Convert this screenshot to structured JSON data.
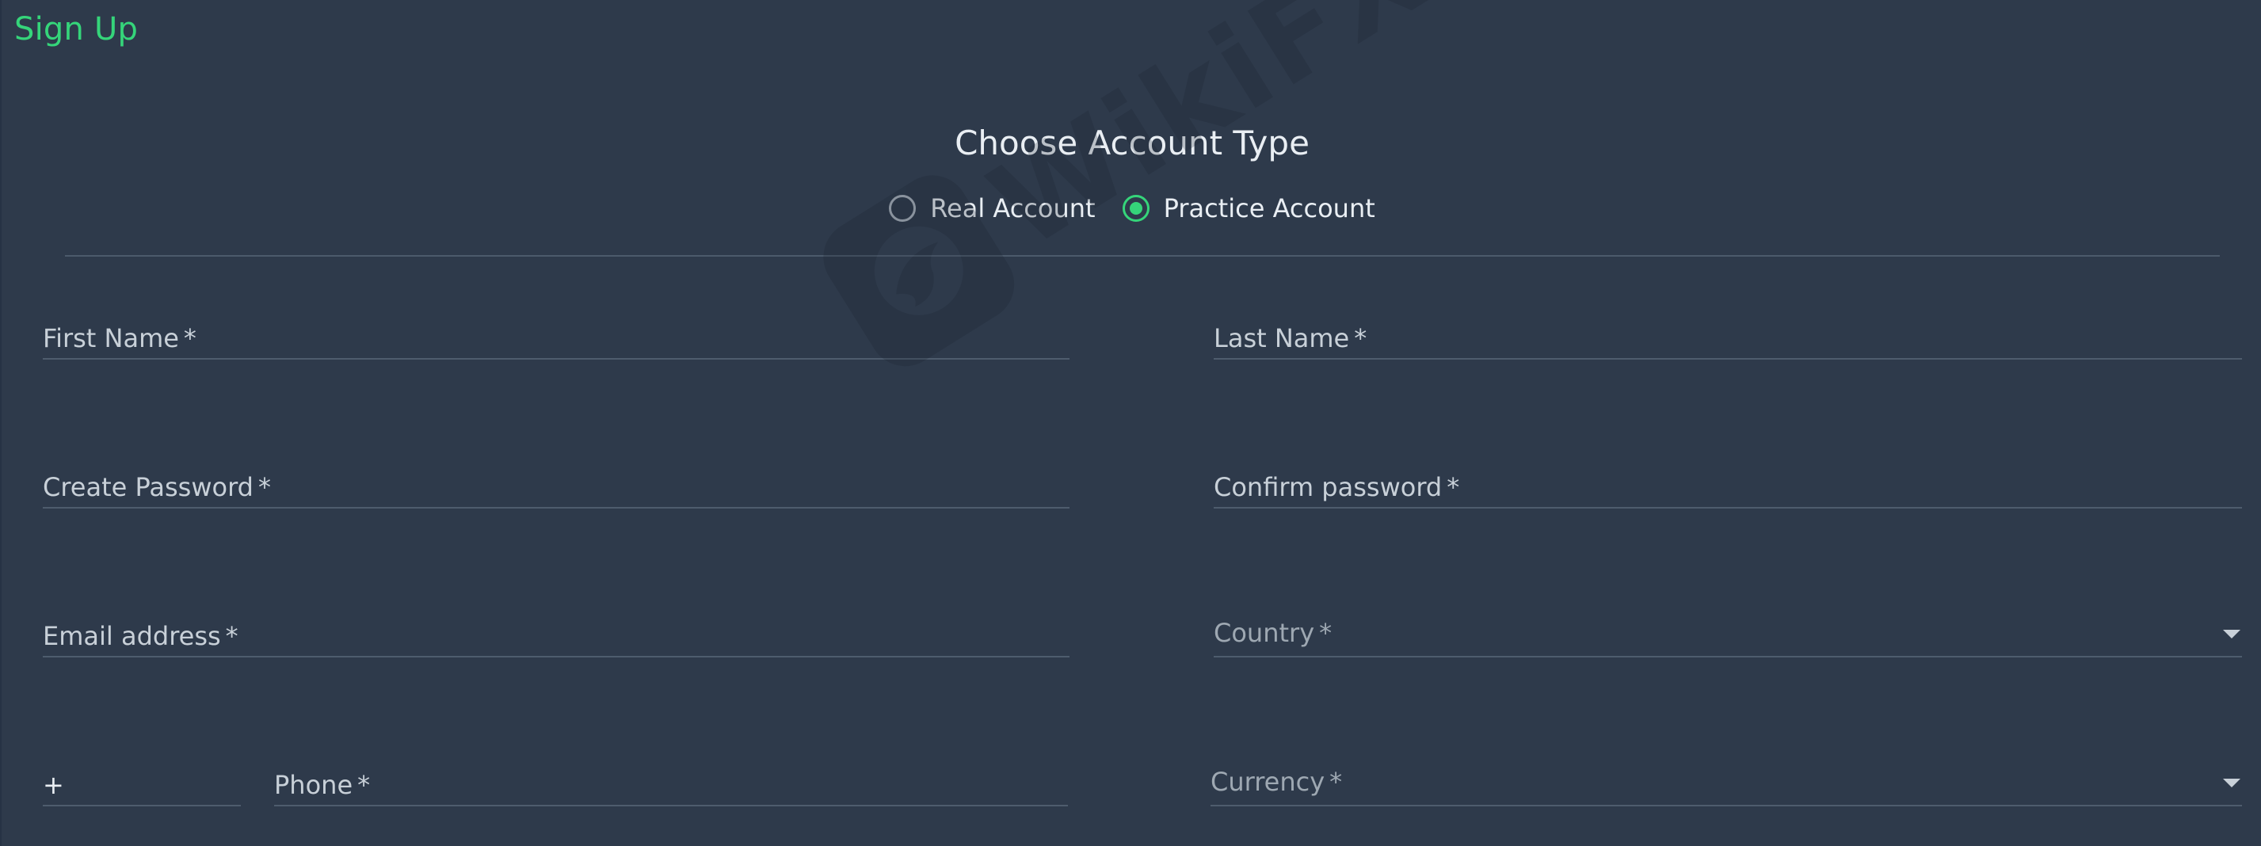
{
  "page": {
    "title": "Sign Up"
  },
  "account_type": {
    "heading": "Choose Account Type",
    "options": [
      {
        "label": "Real Account",
        "selected": false
      },
      {
        "label": "Practice Account",
        "selected": true
      }
    ]
  },
  "form": {
    "first_name": {
      "label": "First Name",
      "required": "*"
    },
    "last_name": {
      "label": "Last Name",
      "required": "*"
    },
    "create_password": {
      "label": "Create Password",
      "required": "*"
    },
    "confirm_password": {
      "label": "Confirm password",
      "required": "*"
    },
    "email": {
      "label": "Email address",
      "required": "*"
    },
    "country": {
      "label": "Country",
      "required": "*"
    },
    "phone_code": {
      "value": "+"
    },
    "phone": {
      "label": "Phone",
      "required": "*"
    },
    "currency": {
      "label": "Currency",
      "required": "*"
    }
  },
  "watermark": {
    "text": "WikiFX",
    "icon": "eagle-logo-icon"
  },
  "colors": {
    "background": "#2e3a4b",
    "accent": "#35d57a",
    "text": "#e9eef3",
    "field_line": "#4e5c6d"
  },
  "icons": {
    "dropdown": "chevron-down-icon",
    "radio": "radio-icon"
  }
}
